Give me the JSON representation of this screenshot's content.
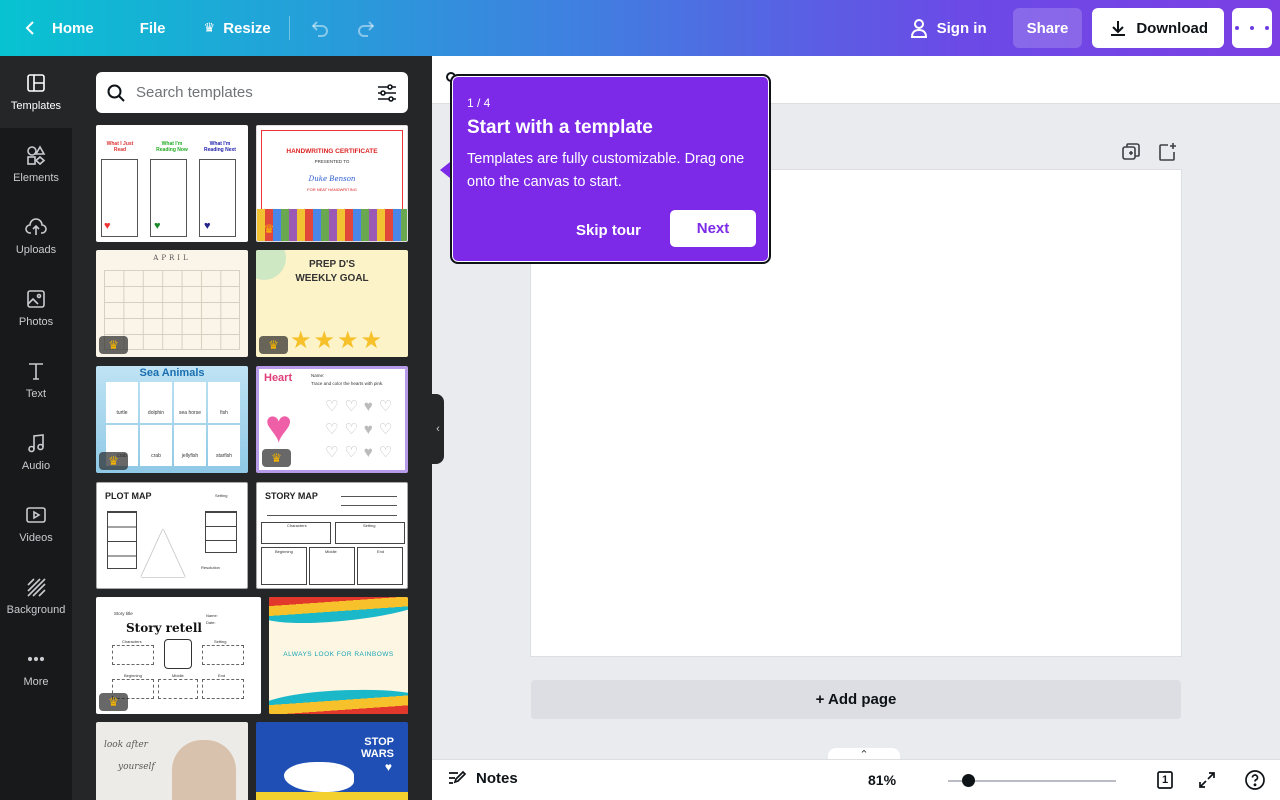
{
  "topbar": {
    "home_label": "Home",
    "file_label": "File",
    "resize_label": "Resize",
    "signin_label": "Sign in",
    "share_label": "Share",
    "download_label": "Download"
  },
  "rail": {
    "items": [
      {
        "label": "Templates"
      },
      {
        "label": "Elements"
      },
      {
        "label": "Uploads"
      },
      {
        "label": "Photos"
      },
      {
        "label": "Text"
      },
      {
        "label": "Audio"
      },
      {
        "label": "Videos"
      },
      {
        "label": "Background"
      },
      {
        "label": "More"
      }
    ]
  },
  "search": {
    "placeholder": "Search templates"
  },
  "templates": {
    "reading": {
      "col1": "What I Just Read",
      "col2": "What I'm Reading Now",
      "col3": "What I'm Reading Next"
    },
    "certificate": {
      "title": "HANDWRITING CERTIFICATE",
      "presented": "PRESENTED TO",
      "name": "Duke Benson",
      "for": "FOR NEAT HANDWRITING"
    },
    "calendar": {
      "month": "APRIL"
    },
    "weekly": {
      "line1": "PREP D'S",
      "line2": "WEEKLY GOAL"
    },
    "sea": {
      "title": "Sea Animals",
      "animals": [
        "turtle",
        "dolphin",
        "sea horse",
        "fish",
        "crab",
        "crab",
        "jellyfish",
        "starfish"
      ]
    },
    "heart": {
      "title": "Heart",
      "name": "Name:",
      "instruction": "Trace and color the hearts with pink."
    },
    "plot": {
      "title": "PLOT MAP",
      "setting": "Setting",
      "resolution": "Resolution"
    },
    "story_map": {
      "title": "STORY MAP",
      "characters": "Characters",
      "setting": "Setting",
      "beginning": "Beginning",
      "middle": "Middle",
      "end": "End"
    },
    "retell": {
      "story_title": "Story title",
      "title": "Story retell",
      "characters": "Characters",
      "setting": "Setting",
      "beginning": "Beginning",
      "middle": "Middle",
      "end": "End",
      "name": "Name:",
      "date": "Date:"
    },
    "rainbow": {
      "text": "ALWAYS LOOK FOR RAINBOWS"
    },
    "look_after": {
      "line1": "look after",
      "line2": "yourself"
    },
    "stop_wars": {
      "line1": "STOP",
      "line2": "WARS"
    }
  },
  "tour": {
    "step": "1 / 4",
    "title": "Start with a template",
    "text": "Templates are fully customizable. Drag one onto the canvas to start.",
    "skip_label": "Skip tour",
    "next_label": "Next"
  },
  "canvas": {
    "add_page_label": "+ Add page"
  },
  "bottombar": {
    "notes_label": "Notes",
    "zoom": "81%",
    "zoom_fraction": 0.12,
    "page_count": "1"
  },
  "colors": {
    "brand_purple": "#7d2ae8",
    "rail_bg": "#18191b",
    "panel_bg": "#252627"
  }
}
